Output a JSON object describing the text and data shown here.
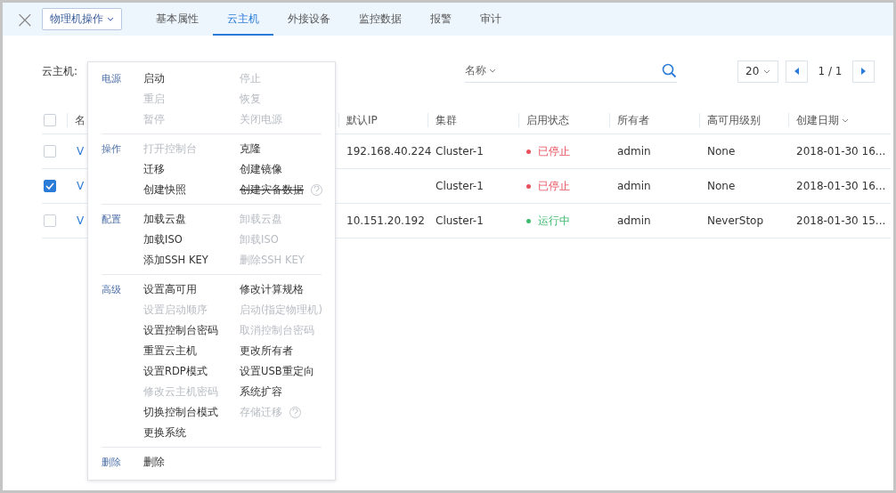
{
  "header": {
    "close": "×",
    "action_button": "物理机操作",
    "tabs": [
      {
        "label": "基本属性",
        "selected": false
      },
      {
        "label": "云主机",
        "selected": true
      },
      {
        "label": "外接设备",
        "selected": false
      },
      {
        "label": "监控数据",
        "selected": false
      },
      {
        "label": "报警",
        "selected": false
      },
      {
        "label": "审计",
        "selected": false
      }
    ]
  },
  "toolbar": {
    "label": "云主机:",
    "search_field": "名称",
    "page_size": "20",
    "page": "1 / 1"
  },
  "table": {
    "select_all": {
      "checked": false
    },
    "columns": [
      {
        "label": "名"
      },
      {
        "label": "默认IP",
        "sorted": false
      },
      {
        "label": "集群",
        "sorted": false
      },
      {
        "label": "启用状态",
        "sorted": false
      },
      {
        "label": "所有者",
        "sorted": false
      },
      {
        "label": "高可用级别",
        "sorted": false
      },
      {
        "label": "创建日期",
        "sorted": true
      }
    ],
    "rows": [
      {
        "selected": false,
        "name": "V",
        "ip": "192.168.40.224",
        "cluster": "Cluster-1",
        "status": "已停止",
        "color": "#e8505b",
        "owner": "admin",
        "ha": "None",
        "created": "2018-01-30 16..."
      },
      {
        "selected": true,
        "name": "V",
        "ip": "",
        "cluster": "Cluster-1",
        "status": "已停止",
        "color": "#e8505b",
        "owner": "admin",
        "ha": "None",
        "created": "2018-01-30 16..."
      },
      {
        "selected": false,
        "name": "V",
        "ip": "10.151.20.192",
        "cluster": "Cluster-1",
        "status": "运行中",
        "color": "#3dbb6d",
        "owner": "admin",
        "ha": "NeverStop",
        "created": "2018-01-30 15..."
      }
    ]
  },
  "menu": {
    "sections": [
      {
        "label": "电源",
        "items": [
          {
            "label": "启动",
            "disabled": false
          },
          {
            "label": "停止",
            "disabled": true
          },
          {
            "label": "重启",
            "disabled": true
          },
          {
            "label": "恢复",
            "disabled": true
          },
          {
            "label": "暂停",
            "disabled": true
          },
          {
            "label": "关闭电源",
            "disabled": true
          }
        ]
      },
      {
        "label": "操作",
        "items": [
          {
            "label": "打开控制台",
            "disabled": true
          },
          {
            "label": "克隆",
            "disabled": false
          },
          {
            "label": "迁移",
            "disabled": false
          },
          {
            "label": "创建镜像",
            "disabled": false
          },
          {
            "label": "创建快照",
            "disabled": false
          },
          {
            "label": "创建灾备数据",
            "disabled": false,
            "struck": true,
            "help": true
          }
        ]
      },
      {
        "label": "配置",
        "items": [
          {
            "label": "加载云盘",
            "disabled": false
          },
          {
            "label": "卸载云盘",
            "disabled": true
          },
          {
            "label": "加载ISO",
            "disabled": false
          },
          {
            "label": "卸载ISO",
            "disabled": true
          },
          {
            "label": "添加SSH KEY",
            "disabled": false
          },
          {
            "label": "删除SSH KEY",
            "disabled": true
          }
        ]
      },
      {
        "label": "高级",
        "items": [
          {
            "label": "设置高可用",
            "disabled": false
          },
          {
            "label": "修改计算规格",
            "disabled": false
          },
          {
            "label": "设置启动顺序",
            "disabled": true
          },
          {
            "label": "启动(指定物理机)",
            "disabled": true
          },
          {
            "label": "设置控制台密码",
            "disabled": false
          },
          {
            "label": "取消控制台密码",
            "disabled": true
          },
          {
            "label": "重置云主机",
            "disabled": false
          },
          {
            "label": "更改所有者",
            "disabled": false
          },
          {
            "label": "设置RDP模式",
            "disabled": false
          },
          {
            "label": "设置USB重定向",
            "disabled": false
          },
          {
            "label": "修改云主机密码",
            "disabled": true
          },
          {
            "label": "系统扩容",
            "disabled": false
          },
          {
            "label": "切换控制台模式",
            "disabled": false
          },
          {
            "label": "存储迁移",
            "disabled": true,
            "help": true
          },
          {
            "label": "更换系统",
            "disabled": false
          }
        ]
      },
      {
        "label": "删除",
        "items": [
          {
            "label": "删除",
            "disabled": false
          }
        ]
      }
    ]
  }
}
